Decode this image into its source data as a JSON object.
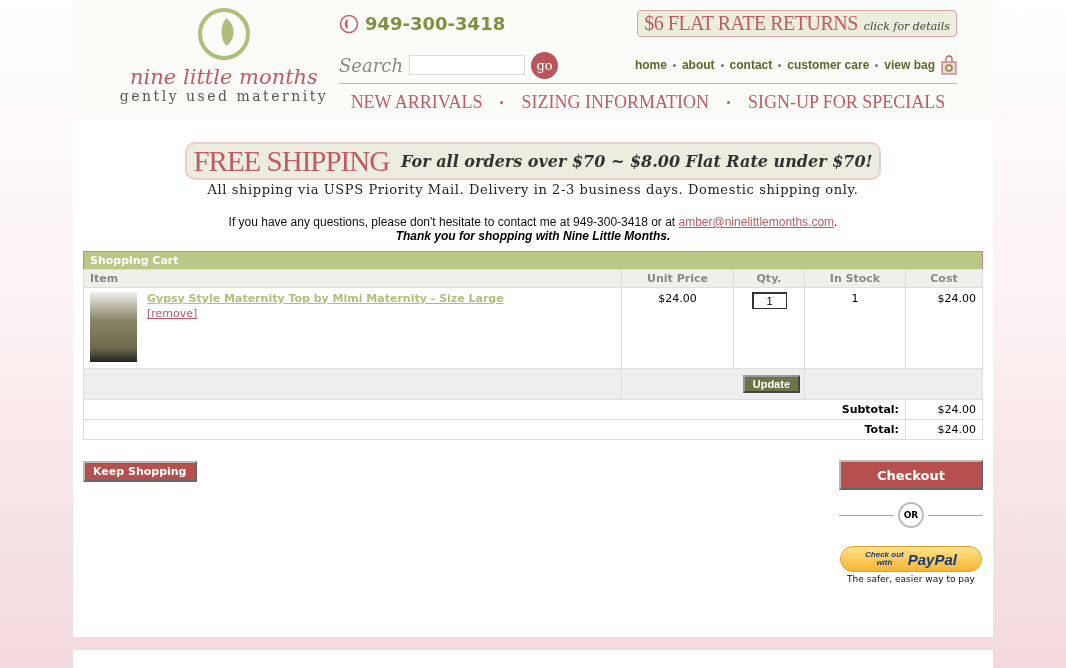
{
  "logo": {
    "name": "nine little months",
    "tagline": "gently used maternity"
  },
  "phone": "949-300-3418",
  "returns_banner": {
    "title": "$6 FLAT RATE RETURNS",
    "link": "click for details"
  },
  "search": {
    "label": "Search",
    "button": "go"
  },
  "top_links": [
    "home",
    "about",
    "contact",
    "customer care",
    "view bag"
  ],
  "main_nav": [
    "NEW ARRIVALS",
    "SIZING INFORMATION",
    "SIGN-UP FOR SPECIALS"
  ],
  "shipping_banner": {
    "title": "FREE SHIPPING",
    "offer": "For all orders over $70 ~ $8.00 Flat Rate under $70!",
    "note": "All shipping via USPS Priority Mail. Delivery in 2-3 business days. Domestic shipping only."
  },
  "contact_note": {
    "text_before": "If you have any questions, please don't hesitate to contact me at 949-300-3418 or at",
    "email": "amber@ninelittlemonths.com",
    "text_after": ".",
    "thanks": "Thank you for shopping with Nine Little Months."
  },
  "cart": {
    "title": "Shopping Cart",
    "columns": [
      "Item",
      "Unit Price",
      "Qty.",
      "In Stock",
      "Cost"
    ],
    "rows": [
      {
        "name": "Gypsy Style Maternity Top by Mimi Maternity - Size Large",
        "remove": "[remove]",
        "unit_price": "$24.00",
        "qty": "1",
        "in_stock": "1",
        "cost": "$24.00"
      }
    ],
    "update": "Update",
    "totals": [
      {
        "label": "Subtotal:",
        "value": "$24.00"
      },
      {
        "label": "Total:",
        "value": "$24.00"
      }
    ]
  },
  "keep_shopping": "Keep Shopping",
  "checkout": "Checkout",
  "or": "OR",
  "paypal": {
    "line1": "Check out",
    "line2": "with",
    "brand": "PayPal",
    "tagline": "The safer, easier way to pay"
  }
}
